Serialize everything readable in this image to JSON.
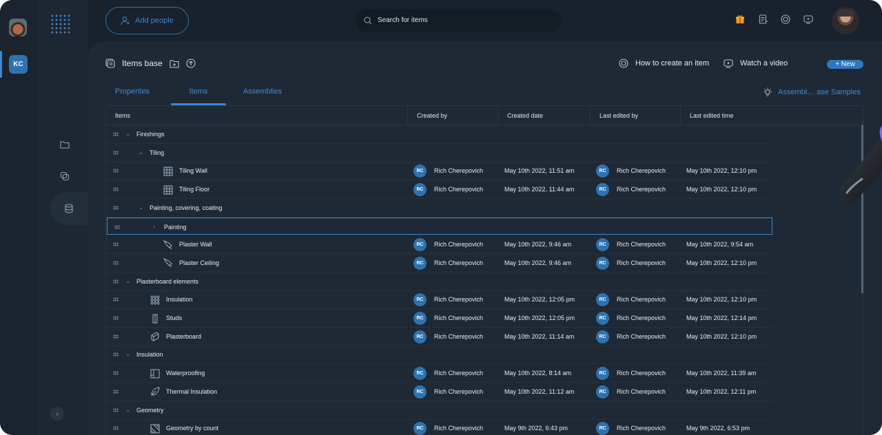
{
  "rail": {
    "org_initials": "KC"
  },
  "topbar": {
    "add_people_label": "Add people",
    "search_placeholder": "Search for items"
  },
  "header": {
    "title": "Items base",
    "how_to_label": "How to create an item",
    "watch_video_label": "Watch a video",
    "new_button_label": "+ New"
  },
  "tabs": [
    {
      "label": "Properties",
      "active": false
    },
    {
      "label": "Items",
      "active": true
    },
    {
      "label": "Assemblies",
      "active": false
    }
  ],
  "samples_link_label": "Assembl… ase Samples",
  "table": {
    "columns": [
      "Items",
      "Created by",
      "Created date",
      "Last edited by",
      "Last edited time"
    ],
    "rows": [
      {
        "kind": "group",
        "level": 0,
        "name": "Finishings",
        "expanded": true
      },
      {
        "kind": "group",
        "level": 1,
        "name": "Tiling",
        "expanded": true
      },
      {
        "kind": "item",
        "level": 2,
        "icon": "tile-grid-icon",
        "name": "Tiling Wall",
        "created_by_initials": "RC",
        "created_by": "Rich Cherepovich",
        "created_date": "May 10th 2022, 11:51 am",
        "edited_by_initials": "RC",
        "edited_by": "Rich Cherepovich",
        "edited_time": "May 10th 2022, 12:10 pm"
      },
      {
        "kind": "item",
        "level": 2,
        "icon": "tile-grid-icon",
        "name": "Tiling Floor",
        "created_by_initials": "RC",
        "created_by": "Rich Cherepovich",
        "created_date": "May 10th 2022, 11:44 am",
        "edited_by_initials": "RC",
        "edited_by": "Rich Cherepovich",
        "edited_time": "May 10th 2022, 12:10 pm"
      },
      {
        "kind": "group",
        "level": 1,
        "name": "Painting, covering, coating",
        "expanded": true
      },
      {
        "kind": "group",
        "level": 2,
        "name": "Painting",
        "expanded": false,
        "selected": true
      },
      {
        "kind": "item",
        "level": 2,
        "icon": "trowel-icon",
        "name": "Plaster Wall",
        "created_by_initials": "RC",
        "created_by": "Rich Cherepovich",
        "created_date": "May 10th 2022, 9:46 am",
        "edited_by_initials": "RC",
        "edited_by": "Rich Cherepovich",
        "edited_time": "May 10th 2022, 9:54 am"
      },
      {
        "kind": "item",
        "level": 2,
        "icon": "trowel-icon",
        "name": "Plaster Ceiling",
        "created_by_initials": "RC",
        "created_by": "Rich Cherepovich",
        "created_date": "May 10th 2022, 9:46 am",
        "edited_by_initials": "RC",
        "edited_by": "Rich Cherepovich",
        "edited_time": "May 10th 2022, 12:10 pm"
      },
      {
        "kind": "group",
        "level": 0,
        "name": "Plasterboard elements",
        "expanded": true
      },
      {
        "kind": "item",
        "level": 1,
        "icon": "insulation-dots-icon",
        "name": "Insulation",
        "created_by_initials": "RC",
        "created_by": "Rich Cherepovich",
        "created_date": "May 10th 2022, 12:05 pm",
        "edited_by_initials": "RC",
        "edited_by": "Rich Cherepovich",
        "edited_time": "May 10th 2022, 12:10 pm"
      },
      {
        "kind": "item",
        "level": 1,
        "icon": "stud-icon",
        "name": "Studs",
        "created_by_initials": "RC",
        "created_by": "Rich Cherepovich",
        "created_date": "May 10th 2022, 12:05 pm",
        "edited_by_initials": "RC",
        "edited_by": "Rich Cherepovich",
        "edited_time": "May 10th 2022, 12:14 pm"
      },
      {
        "kind": "item",
        "level": 1,
        "icon": "board-icon",
        "name": "Plasterboard",
        "created_by_initials": "RC",
        "created_by": "Rich Cherepovich",
        "created_date": "May 10th 2022, 11:14 am",
        "edited_by_initials": "RC",
        "edited_by": "Rich Cherepovich",
        "edited_time": "May 10th 2022, 12:10 pm"
      },
      {
        "kind": "group",
        "level": 0,
        "name": "Insulation",
        "expanded": true
      },
      {
        "kind": "item",
        "level": 1,
        "icon": "waterproofing-icon",
        "name": "Waterproofing",
        "created_by_initials": "RC",
        "created_by": "Rich Cherepovich",
        "created_date": "May 10th 2022, 8:14 am",
        "edited_by_initials": "RC",
        "edited_by": "Rich Cherepovich",
        "edited_time": "May 10th 2022, 11:39 am"
      },
      {
        "kind": "item",
        "level": 1,
        "icon": "thermal-leaf-icon",
        "name": "Thermal Insulation",
        "created_by_initials": "RC",
        "created_by": "Rich Cherepovich",
        "created_date": "May 10th 2022, 11:12 am",
        "edited_by_initials": "RC",
        "edited_by": "Rich Cherepovich",
        "edited_time": "May 10th 2022, 12:11 pm"
      },
      {
        "kind": "group",
        "level": 0,
        "name": "Geometry",
        "expanded": true
      },
      {
        "kind": "item",
        "level": 1,
        "icon": "geometry-count-icon",
        "name": "Geometry by count",
        "created_by_initials": "RC",
        "created_by": "Rich Cherepovich",
        "created_date": "May 9th 2022, 6:43 pm",
        "edited_by_initials": "RC",
        "edited_by": "Rich Cherepovich",
        "edited_time": "May 9th 2022, 6:53 pm"
      }
    ]
  },
  "colors": {
    "accent": "#3b8ad4",
    "background": "#18212c",
    "panel": "#1f2935",
    "avatar_badge": "#2e73b0"
  }
}
